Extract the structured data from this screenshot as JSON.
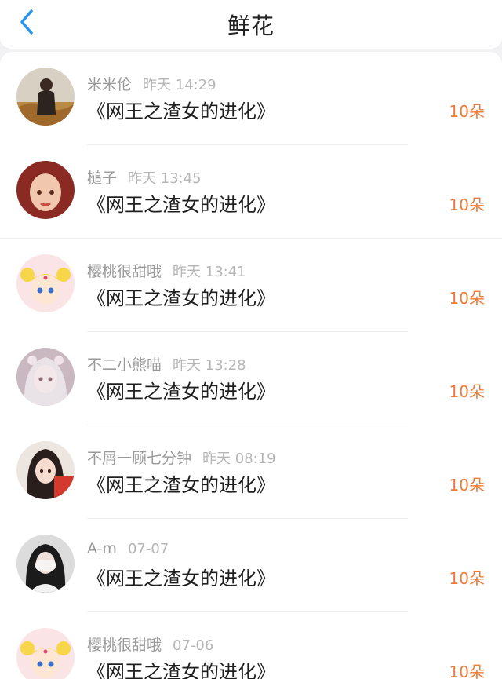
{
  "header": {
    "title": "鲜花"
  },
  "rows": [
    {
      "user": "米米伦",
      "time": "昨天 14:29",
      "book": "《网王之渣女的进化》",
      "count": "10朵"
    },
    {
      "user": "槌子",
      "time": "昨天 13:45",
      "book": "《网王之渣女的进化》",
      "count": "10朵"
    },
    {
      "user": "樱桃很甜哦",
      "time": "昨天 13:41",
      "book": "《网王之渣女的进化》",
      "count": "10朵"
    },
    {
      "user": "不二小熊喵",
      "time": "昨天 13:28",
      "book": "《网王之渣女的进化》",
      "count": "10朵"
    },
    {
      "user": "不屑一顾七分钟",
      "time": "昨天 08:19",
      "book": "《网王之渣女的进化》",
      "count": "10朵"
    },
    {
      "user": "A-m",
      "time": "07-07",
      "book": "《网王之渣女的进化》",
      "count": "10朵"
    },
    {
      "user": "樱桃很甜哦",
      "time": "07-06",
      "book": "《网王之渣女的进化》",
      "count": "10朵"
    }
  ],
  "colors": {
    "accent_count": "#ee7a36",
    "back_arrow": "#2a93ee"
  }
}
